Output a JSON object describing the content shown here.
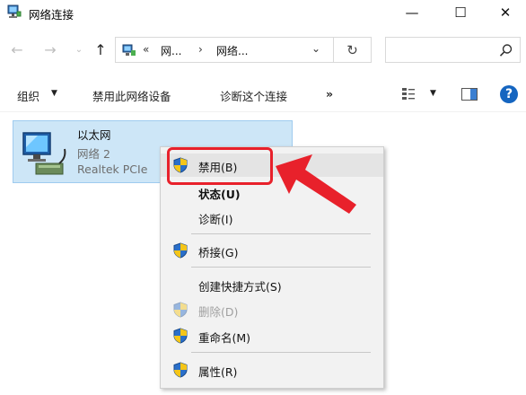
{
  "window": {
    "title": "网络连接",
    "minimize_glyph": "—",
    "maximize_glyph": "☐",
    "close_glyph": "✕"
  },
  "navigation": {
    "back_glyph": "←",
    "forward_glyph": "→",
    "recent_glyph": "⌄",
    "up_glyph": "↑",
    "address": {
      "overflow": "«",
      "segments": [
        "网...",
        "网络..."
      ],
      "separator": "›",
      "dropdown_glyph": "⌄"
    },
    "refresh_glyph": "↻"
  },
  "commandbar": {
    "organize": "组织",
    "disable_device": "禁用此网络设备",
    "diagnose_connection": "诊断这个连接",
    "more": "»",
    "caret": "▼"
  },
  "adapter": {
    "name": "以太网",
    "network": "网络 2",
    "device": "Realtek PCIe"
  },
  "context_menu": {
    "items": [
      {
        "label": "禁用(B)",
        "shield": true,
        "highlighted": true
      },
      {
        "label": "状态(U)",
        "shield": false,
        "bold": true
      },
      {
        "label": "诊断(I)",
        "shield": false
      },
      {
        "label": "桥接(G)",
        "shield": true
      },
      {
        "label": "创建快捷方式(S)",
        "shield": false
      },
      {
        "label": "删除(D)",
        "shield": true,
        "disabled": true
      },
      {
        "label": "重命名(M)",
        "shield": true
      },
      {
        "label": "属性(R)",
        "shield": true
      }
    ]
  },
  "colors": {
    "accent_red": "#e8212b",
    "selection_blue": "#cde6f7",
    "help_blue": "#1565c0"
  },
  "icons": {
    "app": "network-connections-icon",
    "search": "search-icon",
    "help": "help-icon",
    "shield": "uac-shield-icon"
  }
}
